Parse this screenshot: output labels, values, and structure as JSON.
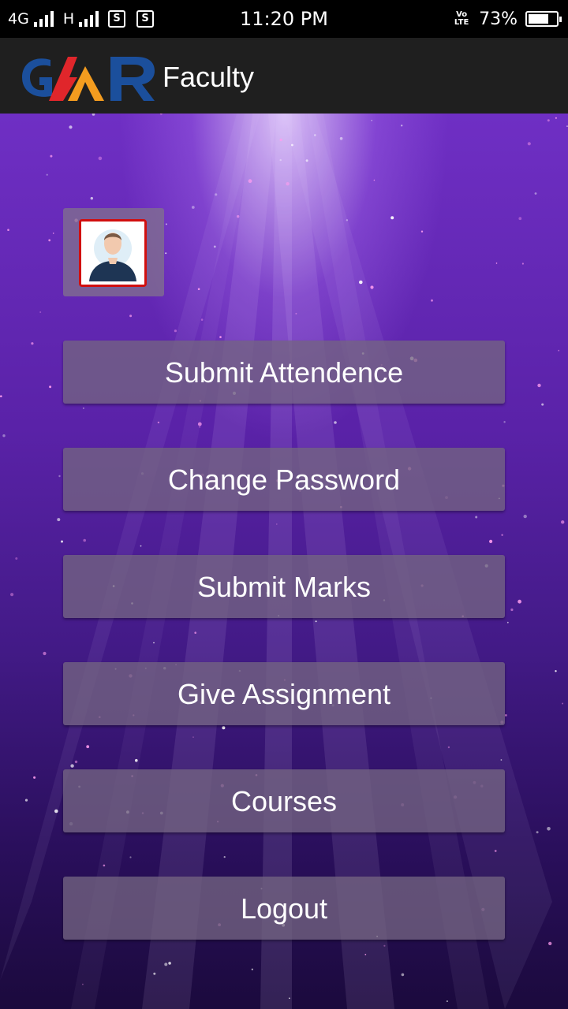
{
  "status_bar": {
    "network_1": "4G",
    "network_2": "H",
    "sim_icon_1": "S",
    "sim_icon_2": "S",
    "time": "11:20 PM",
    "volte": "Vo LTE",
    "battery_percent": "73%",
    "battery_level": 0.73
  },
  "app_bar": {
    "logo_text": "GMR",
    "title": "Faculty"
  },
  "menu": {
    "items": [
      {
        "label": "Submit Attendence"
      },
      {
        "label": "Change Password"
      },
      {
        "label": "Submit Marks"
      },
      {
        "label": "Give Assignment"
      },
      {
        "label": "Courses"
      },
      {
        "label": "Logout"
      }
    ]
  },
  "icons": {
    "avatar": "user-avatar-icon"
  },
  "colors": {
    "logo_blue": "#1b4f9c",
    "logo_red": "#e0262b",
    "logo_orange": "#f39c1f",
    "avatar_border": "#d10f0f",
    "appbar_bg": "#1f1f1f"
  }
}
